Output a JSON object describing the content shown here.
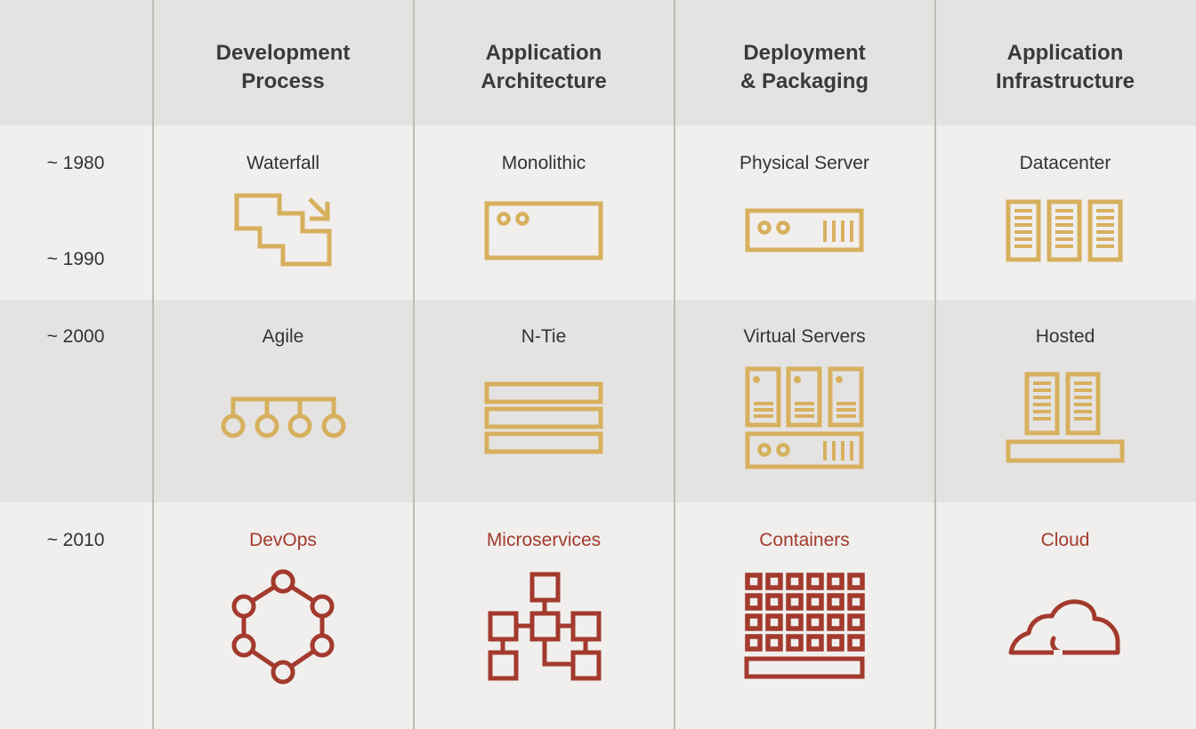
{
  "columns": [
    {
      "title_line1": "Development",
      "title_line2": "Process"
    },
    {
      "title_line1": "Application",
      "title_line2": "Architecture"
    },
    {
      "title_line1": "Deployment",
      "title_line2": "& Packaging"
    },
    {
      "title_line1": "Application",
      "title_line2": "Infrastructure"
    }
  ],
  "years": [
    "~ 1980",
    "~ 1990",
    "~ 2000",
    "~ 2010"
  ],
  "rows": [
    {
      "era": "1980-1990",
      "cells": [
        {
          "label": "Waterfall",
          "icon": "waterfall-stairs-icon"
        },
        {
          "label": "Monolithic",
          "icon": "monolith-box-icon"
        },
        {
          "label": "Physical Server",
          "icon": "physical-server-icon"
        },
        {
          "label": "Datacenter",
          "icon": "datacenter-racks-icon"
        }
      ]
    },
    {
      "era": "2000",
      "cells": [
        {
          "label": "Agile",
          "icon": "agile-iterations-icon"
        },
        {
          "label": "N-Tie",
          "icon": "n-tier-layers-icon"
        },
        {
          "label": "Virtual Servers",
          "icon": "virtual-servers-icon"
        },
        {
          "label": "Hosted",
          "icon": "hosted-racks-icon"
        }
      ]
    },
    {
      "era": "2010",
      "cells": [
        {
          "label": "DevOps",
          "icon": "devops-ring-icon"
        },
        {
          "label": "Microservices",
          "icon": "microservices-network-icon"
        },
        {
          "label": "Containers",
          "icon": "containers-grid-icon"
        },
        {
          "label": "Cloud",
          "icon": "cloud-icon"
        }
      ]
    }
  ],
  "colors": {
    "legacy_icon": "#d7b05e",
    "modern_accent": "#a33a2d",
    "header_bg": "#e4e3e1",
    "light_bg": "#f0efed",
    "text": "#333333"
  }
}
